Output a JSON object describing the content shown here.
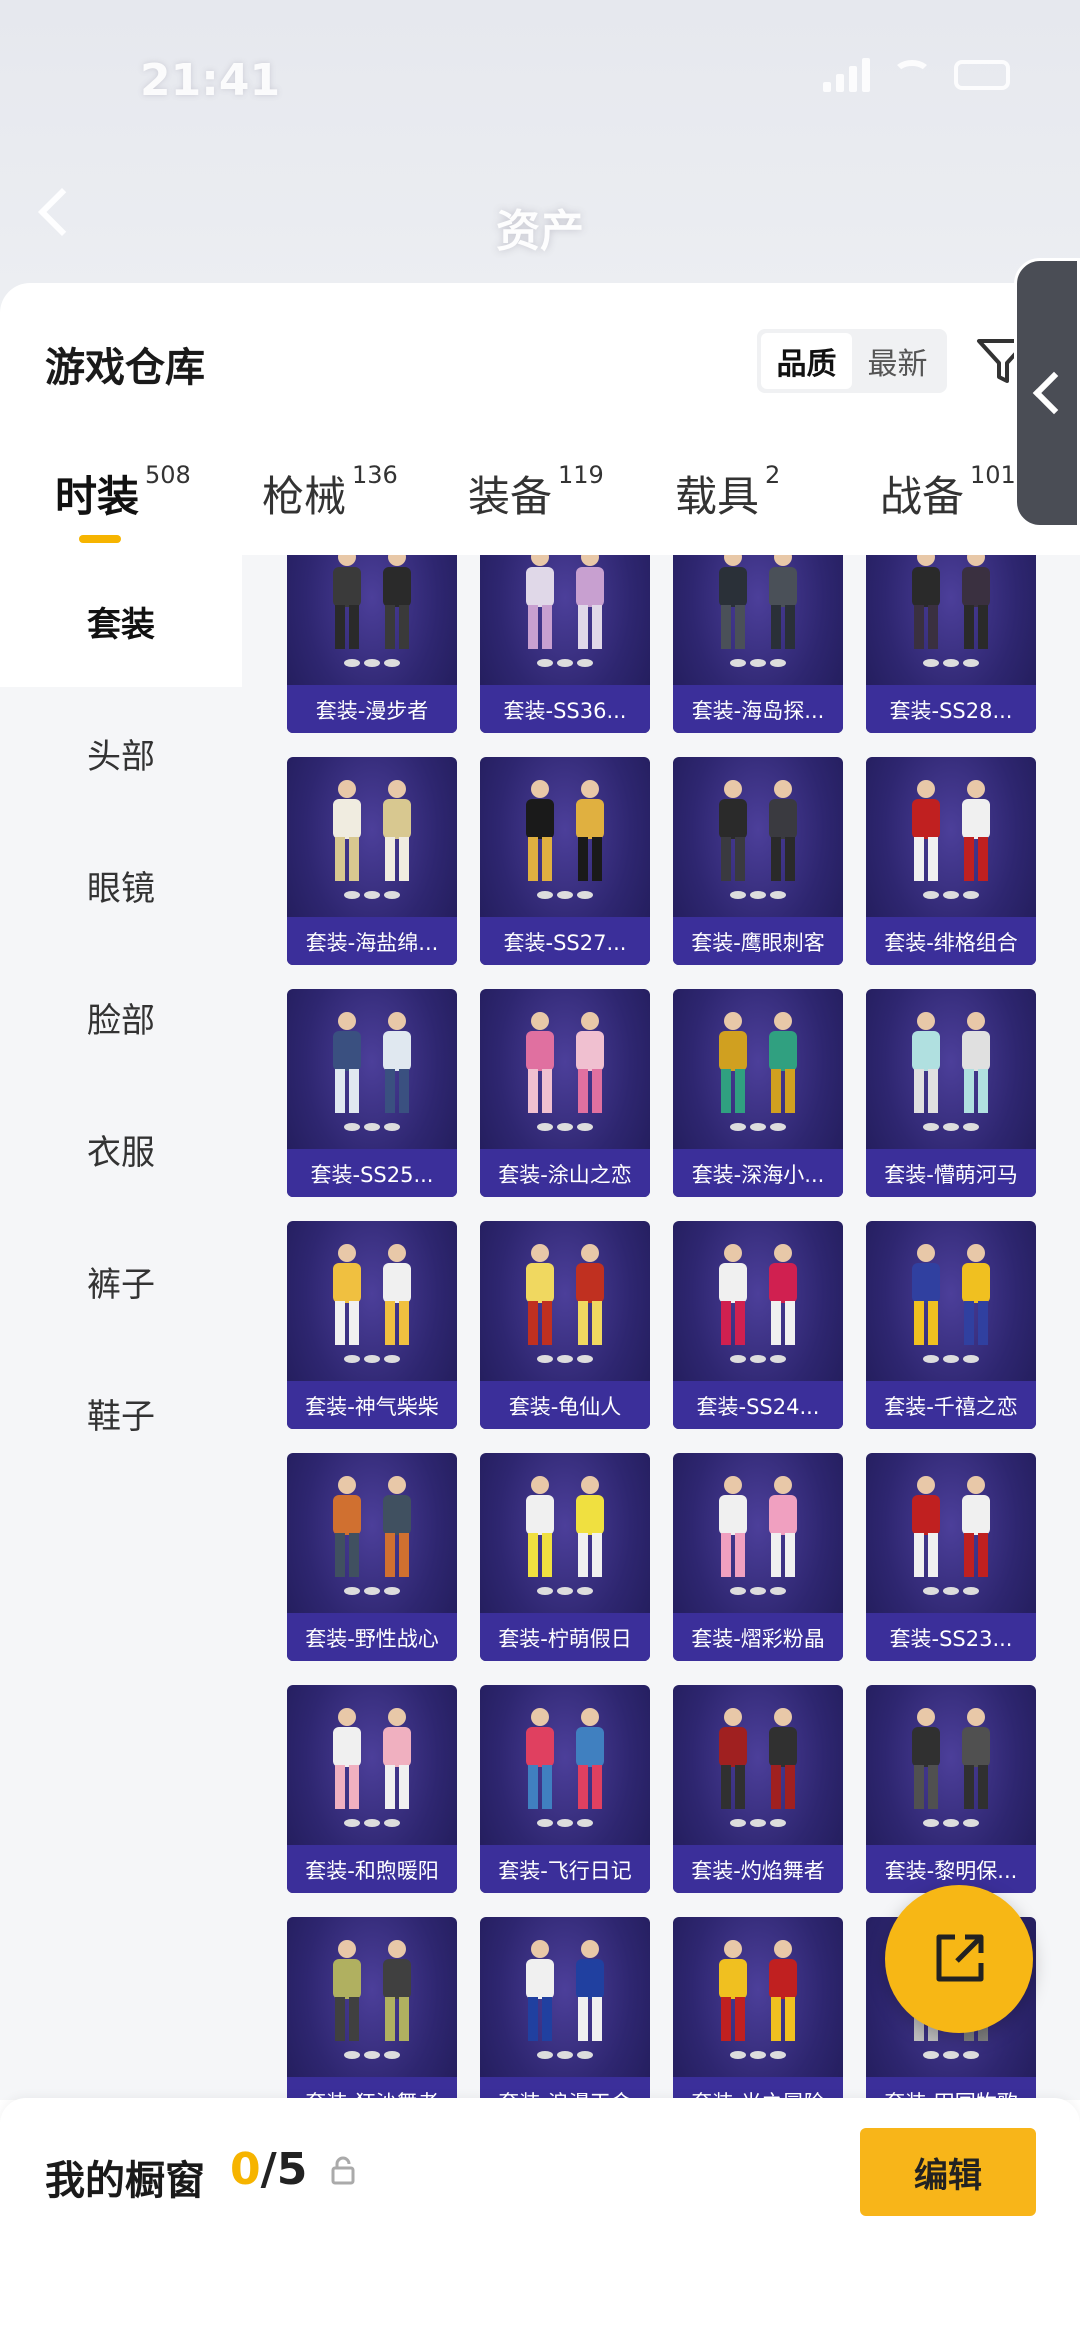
{
  "status_bar": {
    "time": "21:41"
  },
  "header": {
    "title": "资产"
  },
  "sheet": {
    "title": "游戏仓库",
    "sort_options": [
      "品质",
      "最新"
    ],
    "active_sort": "品质"
  },
  "tabs": [
    {
      "label": "时装",
      "count": "508"
    },
    {
      "label": "枪械",
      "count": "136"
    },
    {
      "label": "装备",
      "count": "119"
    },
    {
      "label": "载具",
      "count": "2"
    },
    {
      "label": "战备",
      "count": "101"
    }
  ],
  "sidebar": [
    "套装",
    "头部",
    "眼镜",
    "脸部",
    "衣服",
    "裤子",
    "鞋子"
  ],
  "items": [
    "套装-漫步者",
    "套装-SS36...",
    "套装-海岛探...",
    "套装-SS28...",
    "套装-海盐绵...",
    "套装-SS27...",
    "套装-鹰眼刺客",
    "套装-绯格组合",
    "套装-SS25...",
    "套装-涂山之恋",
    "套装-深海小...",
    "套装-懵萌河马",
    "套装-神气柴柴",
    "套装-龟仙人",
    "套装-SS24...",
    "套装-千禧之恋",
    "套装-野性战心",
    "套装-柠萌假日",
    "套装-熠彩粉晶",
    "套装-SS23...",
    "套装-和煦暖阳",
    "套装-飞行日记",
    "套装-灼焰舞者",
    "套装-黎明保...",
    "套装-狂沙舞者",
    "套装-浪漫天命",
    "套装-光之冒险",
    "套装-田园牧歌"
  ],
  "outfit_colors": [
    [
      "#3a3a3a",
      "#2a2a2a"
    ],
    [
      "#e0d8e8",
      "#c8a0d0"
    ],
    [
      "#2a3038",
      "#4a5058"
    ],
    [
      "#2a2a2a",
      "#3a3040"
    ],
    [
      "#f0ece0",
      "#d8c890"
    ],
    [
      "#1a1a1a",
      "#e0b040"
    ],
    [
      "#2a2a2a",
      "#3a3a40"
    ],
    [
      "#c02020",
      "#f0f0f0"
    ],
    [
      "#3a5080",
      "#e0e8f0"
    ],
    [
      "#e070a0",
      "#f0c0d0"
    ],
    [
      "#d0a020",
      "#30a080"
    ],
    [
      "#b0e0e0",
      "#e0e0e0"
    ],
    [
      "#f0c040",
      "#f0f0f0"
    ],
    [
      "#f0d860",
      "#c03020"
    ],
    [
      "#f0f0f0",
      "#d02050"
    ],
    [
      "#3040a0",
      "#f0c020"
    ],
    [
      "#d07030",
      "#405060"
    ],
    [
      "#f0f0f0",
      "#f0e040"
    ],
    [
      "#f0f0f0",
      "#f0a0c0"
    ],
    [
      "#c02020",
      "#f0f0f0"
    ],
    [
      "#f0f0f0",
      "#f0b0c0"
    ],
    [
      "#e04060",
      "#4080c0"
    ],
    [
      "#a02020",
      "#303030"
    ],
    [
      "#303030",
      "#505050"
    ],
    [
      "#b0b060",
      "#404040"
    ],
    [
      "#f0f0f0",
      "#2040a0"
    ],
    [
      "#f0c020",
      "#c02020"
    ],
    [
      "#808080",
      "#c0c0c0"
    ]
  ],
  "showcase": {
    "title": "我的橱窗",
    "current": "0",
    "total": "/5",
    "edit_label": "编辑"
  }
}
